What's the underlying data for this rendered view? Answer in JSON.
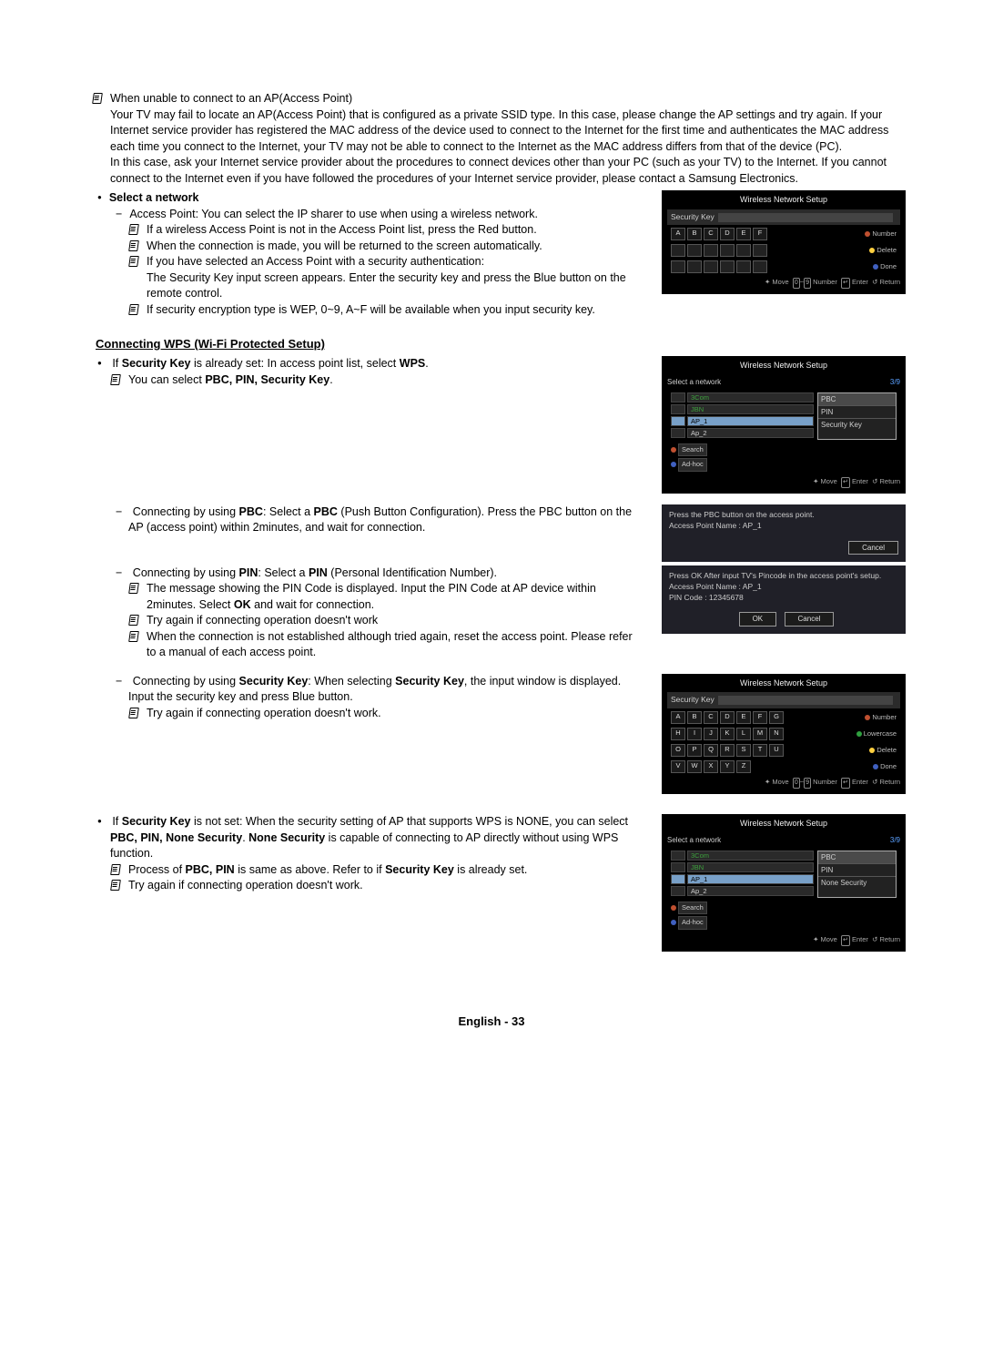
{
  "intro": {
    "note1_prefix": "When unable to connect to an AP(Access Point)",
    "note1_body": "Your TV may fail to locate an AP(Access Point) that is configured as a private SSID type. In this case, please change the AP settings and try again. If your Internet service provider has registered the MAC address of the device used to connect to the Internet for the first time and authenticates the MAC address each time you connect to the Internet, your TV may not be able to connect to the Internet as the MAC address differs from that of the device (PC).",
    "note1_body2": "In this case, ask your Internet service provider about the procedures to connect devices other than your PC (such as your TV) to the Internet. If you cannot connect to the Internet even if you have followed the procedures of your Internet service provider, please contact a Samsung Electronics."
  },
  "select_network": {
    "heading": "Select a network",
    "line1": "Access Point: You can select the IP sharer to use when using a wireless network.",
    "n1": "If a wireless Access Point is not in the Access Point list, press the Red button.",
    "n2": "When the connection is made, you will be returned to the screen automatically.",
    "n3": "If you have selected an Access Point with a security authentication:",
    "n3_a": "The Security Key input screen appears. Enter the security key and press the Blue button on the remote control.",
    "n4": "If security encryption type is WEP, 0~9, A~F will be available when you input security key."
  },
  "wps": {
    "heading": "Connecting WPS (Wi-Fi Protected Setup)",
    "if_set_prefix": "If ",
    "security_key": "Security Key",
    "if_set_mid1": " is already set: In access point list, select ",
    "wps_word": "WPS",
    "if_set_mid2": ".",
    "can_select_prefix": "You can select ",
    "can_select_bold": "PBC, PIN, Security Key",
    "can_select_suffix": ".",
    "pbc_prefix": "Connecting by using ",
    "pbc_b1": "PBC",
    "pbc_mid1": ": Select a ",
    "pbc_b2": "PBC",
    "pbc_suffix": " (Push Button Configuration). Press the PBC button on the AP (access point) within 2minutes, and wait for connection.",
    "pin_prefix": "Connecting by using ",
    "pin_b1": "PIN",
    "pin_mid1": ": Select a ",
    "pin_b2": "PIN",
    "pin_suffix": " (Personal Identification Number).",
    "pin_n1_a": "The message showing the PIN Code is displayed. Input the PIN Code at AP device within 2minutes. Select ",
    "pin_n1_b": "OK",
    "pin_n1_c": " and wait for connection.",
    "pin_n2": "Try again if connecting operation doesn't work",
    "pin_n3": "When the connection is not established although tried again, reset the access point. Please refer to a manual of each access point.",
    "sec_prefix": "Connecting by using ",
    "sec_b1": "Security Key",
    "sec_mid": ": When selecting ",
    "sec_b2": "Security Key",
    "sec_suffix": ", the input window is displayed. Input the security key and press Blue button.",
    "sec_n1": "Try again if connecting operation doesn't work.",
    "not_set_prefix": "If ",
    "not_set_mid1": " is not set: When the security setting of AP that supports WPS is NONE, you can select ",
    "not_set_b2": "PBC, PIN, None Security",
    "not_set_mid2": ". ",
    "not_set_b3": "None Security",
    "not_set_suffix": " is capable of connecting to AP directly without using WPS function.",
    "not_set_n1_a": "Process of ",
    "not_set_n1_b": "PBC, PIN",
    "not_set_n1_c": " is same as above. Refer to if ",
    "not_set_n1_d": "Security Key",
    "not_set_n1_e": " is already set.",
    "not_set_n2": "Try again if connecting operation doesn't work."
  },
  "panel1": {
    "title": "Wireless Network Setup",
    "sec_key": "Security Key",
    "keys": [
      "A",
      "B",
      "C",
      "D",
      "E",
      "F"
    ],
    "leg_number": "Number",
    "leg_delete": "Delete",
    "leg_done": "Done",
    "footer_move": "Move",
    "footer_num": "Number",
    "footer_enter": "Enter",
    "footer_return": "Return"
  },
  "panel2": {
    "title": "Wireless Network Setup",
    "select": "Select a network",
    "ratio": "3/9",
    "items": [
      "3Com",
      "JBN",
      "AP_1",
      "Ap_2"
    ],
    "dd": [
      "PBC",
      "PIN",
      "Security Key"
    ],
    "search": "Search",
    "adhoc": "Ad-hoc",
    "footer_move": "Move",
    "footer_enter": "Enter",
    "footer_return": "Return"
  },
  "panel3": {
    "line1": "Press the PBC button on the access point.",
    "line2": "Access Point Name : AP_1",
    "cancel": "Cancel"
  },
  "panel4": {
    "line1": "Press OK After input TV's Pincode in the access point's setup.",
    "line2": "Access Point Name : AP_1",
    "line3": "PIN Code : 12345678",
    "ok": "OK",
    "cancel": "Cancel"
  },
  "panel5": {
    "title": "Wireless Network Setup",
    "sec_key": "Security Key",
    "keys_r1": [
      "A",
      "B",
      "C",
      "D",
      "E",
      "F",
      "G"
    ],
    "keys_r2": [
      "H",
      "I",
      "J",
      "K",
      "L",
      "M",
      "N"
    ],
    "keys_r3": [
      "O",
      "P",
      "Q",
      "R",
      "S",
      "T",
      "U"
    ],
    "keys_r4": [
      "V",
      "W",
      "X",
      "Y",
      "Z"
    ],
    "leg_number": "Number",
    "leg_lower": "Lowercase",
    "leg_delete": "Delete",
    "leg_done": "Done",
    "footer_move": "Move",
    "footer_num": "Number",
    "footer_enter": "Enter",
    "footer_return": "Return"
  },
  "panel6": {
    "title": "Wireless Network Setup",
    "select": "Select a network",
    "ratio": "3/9",
    "items": [
      "3Com",
      "JBN",
      "AP_1",
      "Ap_2"
    ],
    "dd": [
      "PBC",
      "PIN",
      "None Security"
    ],
    "search": "Search",
    "adhoc": "Ad-hoc",
    "footer_move": "Move",
    "footer_enter": "Enter",
    "footer_return": "Return"
  },
  "footer": {
    "text": "English - 33"
  }
}
